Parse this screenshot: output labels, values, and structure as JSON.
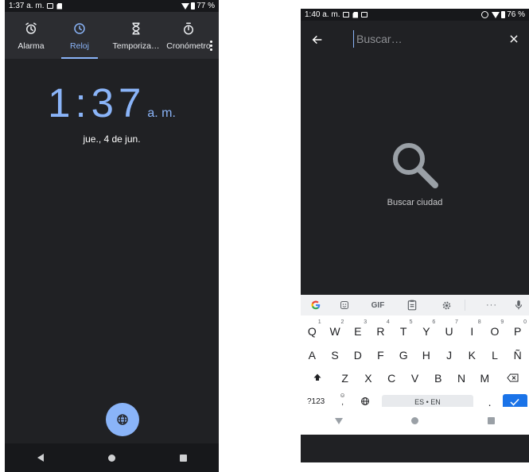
{
  "left": {
    "status": {
      "time": "1:37 a. m.",
      "battery": "77 %"
    },
    "tabs": [
      {
        "label": "Alarma",
        "icon": "alarm-icon"
      },
      {
        "label": "Reloj",
        "icon": "clock-icon",
        "active": true
      },
      {
        "label": "Temporiza…",
        "icon": "hourglass-icon"
      },
      {
        "label": "Cronómetro",
        "icon": "stopwatch-icon"
      }
    ],
    "clock": {
      "time": "1:37",
      "ampm": "a. m.",
      "date": "jue., 4 de jun."
    },
    "fab_icon": "globe-icon",
    "accent": "#8ab4f8"
  },
  "right": {
    "status": {
      "time": "1:40 a. m.",
      "battery": "76 %"
    },
    "search": {
      "placeholder": "Buscar…",
      "value": ""
    },
    "empty_state": {
      "text": "Buscar ciudad",
      "icon": "search-icon"
    },
    "keyboard": {
      "toolbar": [
        "google-icon",
        "sticker-icon",
        "GIF",
        "clipboard-icon",
        "settings-icon",
        "more-icon",
        "mic-icon"
      ],
      "gif_label": "GIF",
      "more_label": "···",
      "row1": [
        [
          "Q",
          "1"
        ],
        [
          "W",
          "2"
        ],
        [
          "E",
          "3"
        ],
        [
          "R",
          "4"
        ],
        [
          "T",
          "5"
        ],
        [
          "Y",
          "6"
        ],
        [
          "U",
          "7"
        ],
        [
          "I",
          "8"
        ],
        [
          "O",
          "9"
        ],
        [
          "P",
          "0"
        ]
      ],
      "row2": [
        "A",
        "S",
        "D",
        "F",
        "G",
        "H",
        "J",
        "K",
        "L",
        "Ñ"
      ],
      "row3": [
        "Z",
        "X",
        "C",
        "V",
        "B",
        "N",
        "M"
      ],
      "symbols_label": "?123",
      "comma_label": ",",
      "emoji_label": "☺",
      "space_label": "ES • EN",
      "period_label": ".",
      "enter_color": "#1a73e8"
    }
  }
}
